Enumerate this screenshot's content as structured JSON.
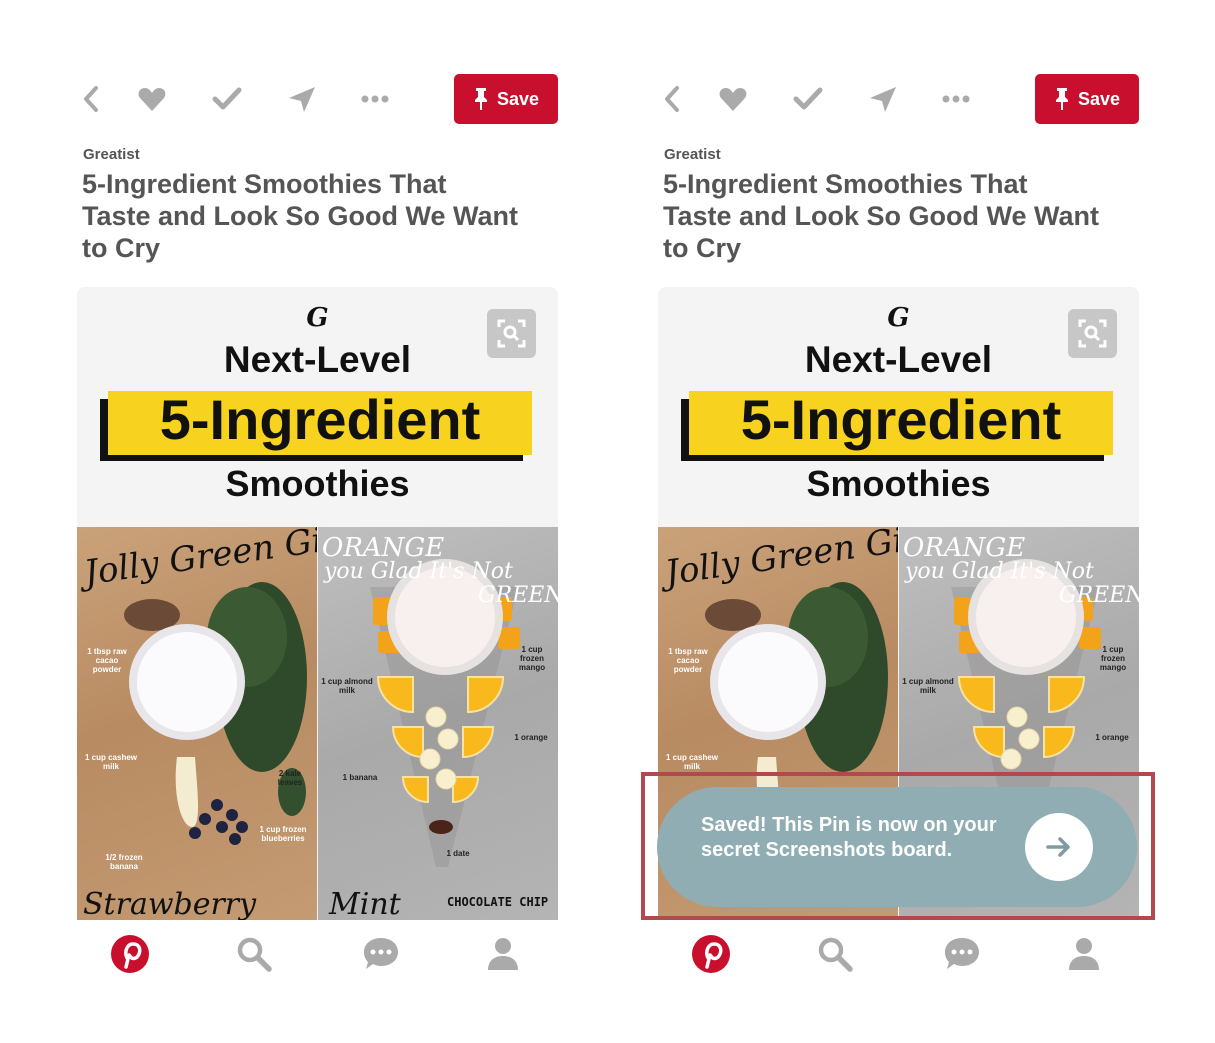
{
  "screens": [
    {
      "id": "before",
      "save_label": "Save",
      "source": "Greatist",
      "title": "5-Ingredient Smoothies That Taste and Look So Good We Want to Cry"
    },
    {
      "id": "after",
      "save_label": "Save",
      "source": "Greatist",
      "title": "5-Ingredient Smoothies That Taste and Look So Good We Want to Cry",
      "toast": {
        "message": "Saved! This Pin is now on your secret Screenshots board.",
        "icon": "arrow-right-icon"
      }
    }
  ],
  "toolbar_icons": [
    "back-icon",
    "heart-icon",
    "check-icon",
    "send-icon",
    "more-icon"
  ],
  "nav_icons": [
    "pinterest-home-icon",
    "search-icon",
    "messages-icon",
    "profile-icon"
  ],
  "pin_image": {
    "logo": "G",
    "headline_1": "Next-Level",
    "headline_2": "5-Ingredient",
    "headline_3": "Smoothies",
    "green_title": "Jolly Green Giant",
    "orange_title_1": "ORANGE",
    "orange_title_2": "you Glad It's Not",
    "orange_title_3": "GREEN",
    "green_labels": [
      "1 tbsp raw cacao powder",
      "1 cup cashew milk",
      "2 kale leaves",
      "1 cup frozen blueberries",
      "1/2 frozen banana"
    ],
    "orange_labels": [
      "1 cup almond milk",
      "1 cup frozen mango",
      "1 orange",
      "1 banana",
      "1 date"
    ],
    "strip_left": "Strawberry",
    "strip_mid": "Mint",
    "strip_right": "CHOCOLATE CHIP"
  },
  "colors": {
    "brand_red": "#c8102e",
    "toast_bg": "#8fadb2",
    "highlight_border": "#b04a4e",
    "icon_gray": "#aaaaaa",
    "text_gray": "#555555",
    "headline_yellow": "#f7d21e"
  }
}
